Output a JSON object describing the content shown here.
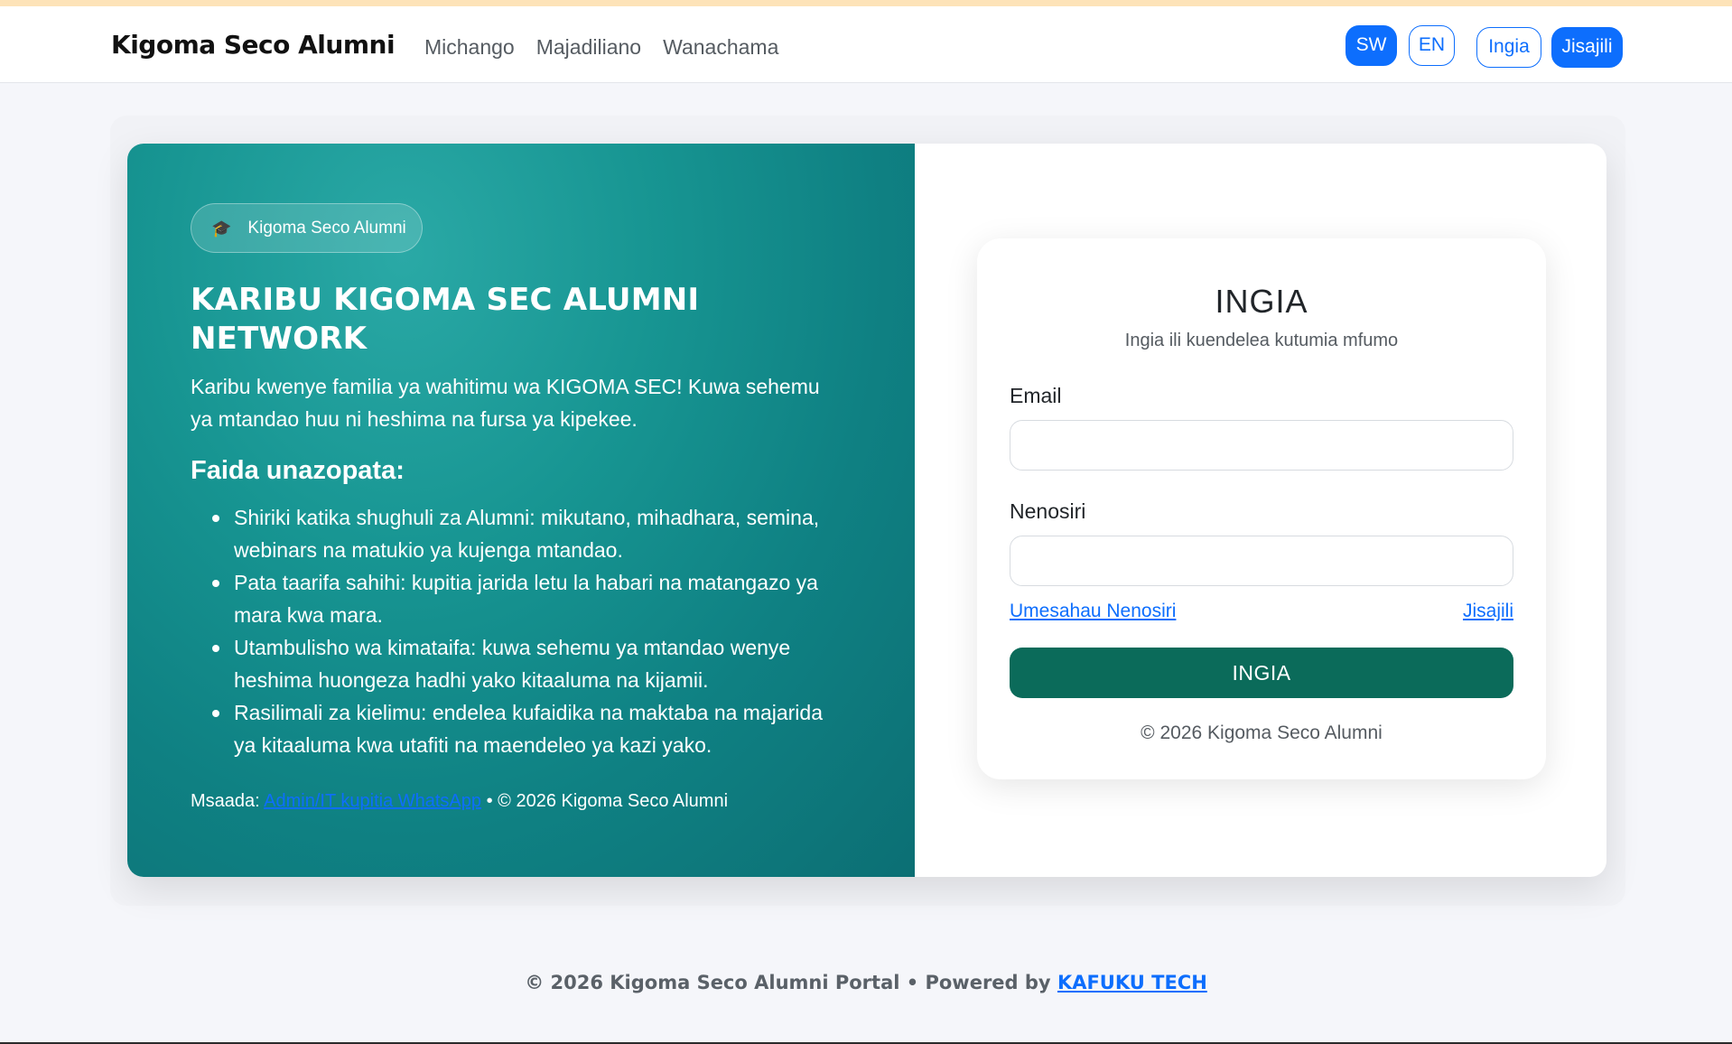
{
  "navbar": {
    "brand": "Kigoma Seco Alumni",
    "links": [
      "Michango",
      "Majadiliano",
      "Wanachama"
    ],
    "lang_sw": "SW",
    "lang_en": "EN",
    "login": "Ingia",
    "register": "Jisajili"
  },
  "hero": {
    "badge_icon": "graduation-cap-icon",
    "badge_glyph": "🎓",
    "badge_text": "Kigoma Seco Alumni",
    "title": "KARIBU KIGOMA SEC ALUMNI NETWORK",
    "intro": "Karibu kwenye familia ya wahitimu wa KIGOMA SEC! Kuwa sehemu ya mtandao huu ni heshima na fursa ya kipekee.",
    "benefits_heading": "Faida unazopata:",
    "benefits": [
      "Shiriki katika shughuli za Alumni: mikutano, mihadhara, semina, webinars na matukio ya kujenga mtandao.",
      "Pata taarifa sahihi: kupitia jarida letu la habari na matangazo ya mara kwa mara.",
      "Utambulisho wa kimataifa: kuwa sehemu ya mtandao wenye heshima huongeza hadhi yako kitaaluma na kijamii.",
      "Rasilimali za kielimu: endelea kufaidika na maktaba na majarida ya kitaaluma kwa utafiti na maendeleo ya kazi yako."
    ],
    "help_label": "Msaada:",
    "help_link": "Admin/IT kupitia WhatsApp",
    "footer_copy": "• © 2026 Kigoma Seco Alumni"
  },
  "login": {
    "title": "INGIA",
    "subtitle": "Ingia ili kuendelea kutumia mfumo",
    "email_label": "Email",
    "email_value": "",
    "password_label": "Nenosiri",
    "password_value": "",
    "forgot_link": "Umesahau Nenosiri",
    "register_link": "Jisajili",
    "submit": "INGIA",
    "copyright": "© 2026 Kigoma Seco Alumni"
  },
  "footer": {
    "text": "© 2026 Kigoma Seco Alumni Portal • Powered by",
    "brand_link": "KAFUKU TECH"
  },
  "colors": {
    "accent": "#0d6efd",
    "hero_teal": "#179592",
    "submit_green": "#0b6b5a",
    "page_bg": "#f5f6fa"
  }
}
